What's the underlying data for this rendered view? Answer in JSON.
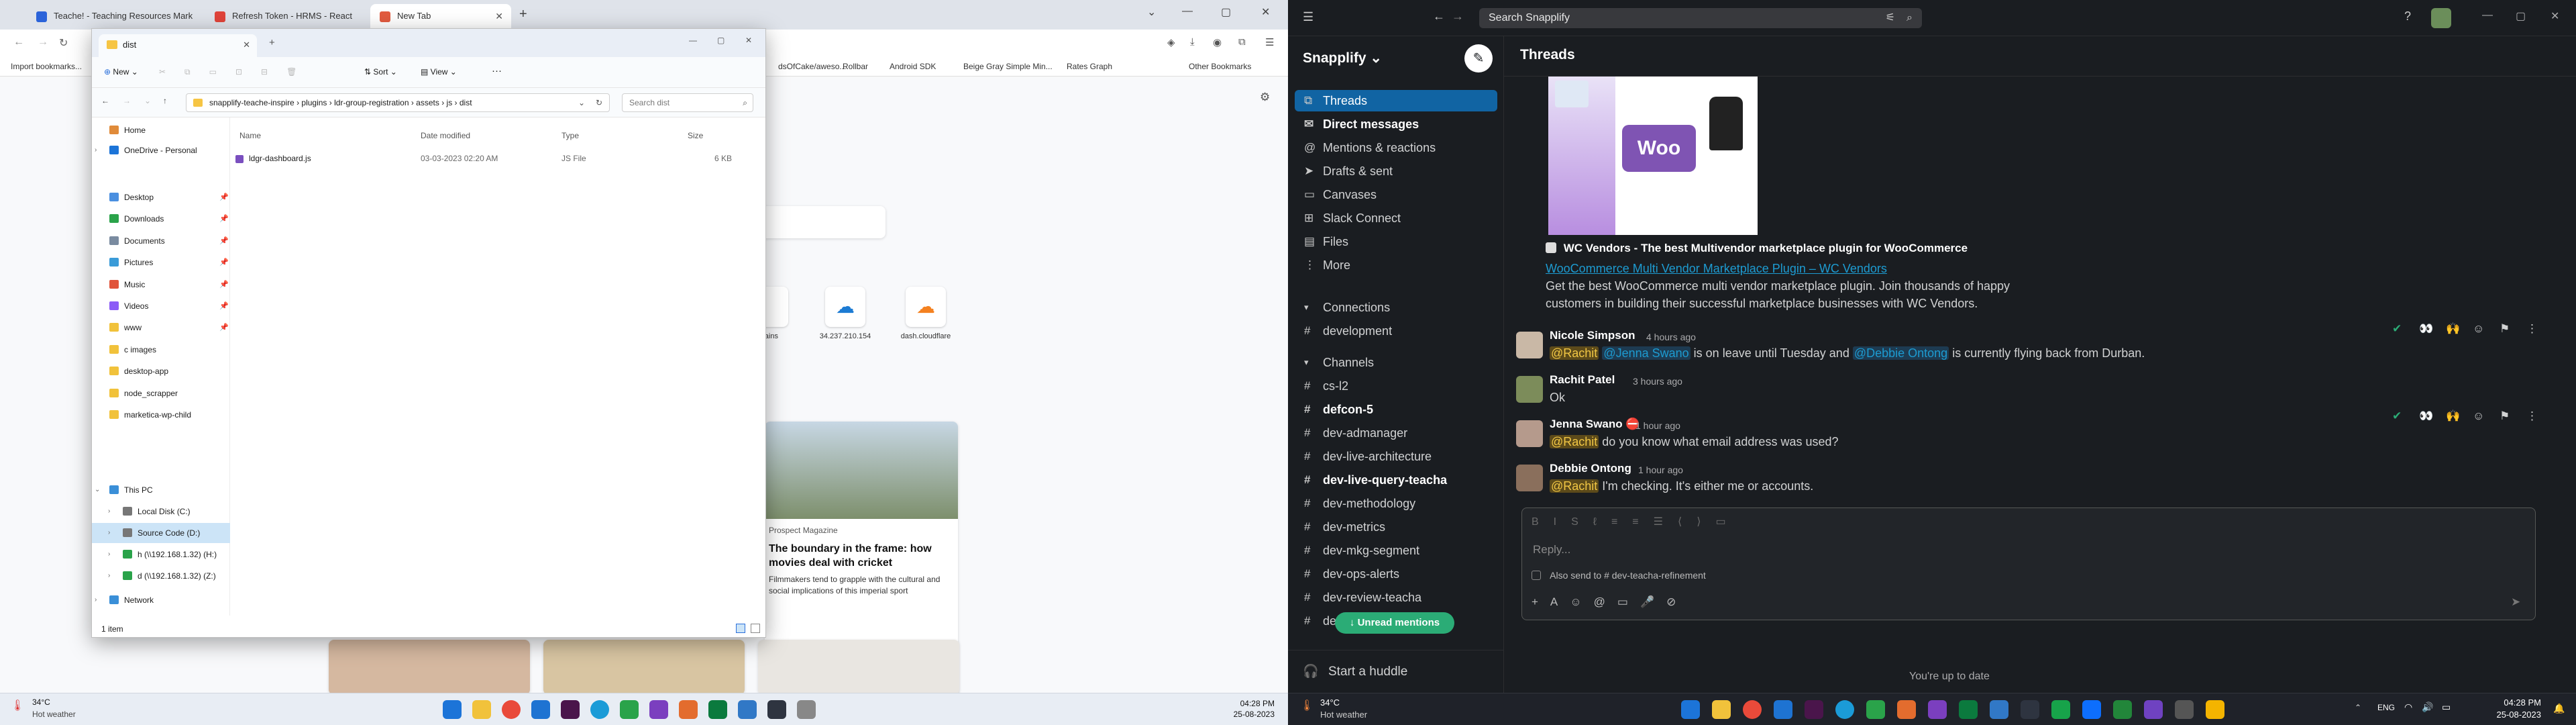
{
  "left": {
    "browser": {
      "tabs": [
        {
          "label": "Teache! - Teaching Resources Mark",
          "color": "#2b63d9"
        },
        {
          "label": "Refresh Token - HRMS - React",
          "color": "#e0433a"
        },
        {
          "label": "New Tab",
          "color": "#e25b3f"
        }
      ],
      "new_tab_symbol": "+",
      "bookmarks": [
        "Import bookmarks...",
        "dsOfCake/aweso...",
        "Rollbar",
        "Android SDK",
        "Beige Gray Simple Min...",
        "Rates Graph",
        "Other Bookmarks"
      ]
    },
    "explorer": {
      "title": "dist",
      "new_label": "New",
      "sort_label": "Sort",
      "view_label": "View",
      "more_label": "···",
      "breadcrumb": [
        "snapplify-teache-inspire",
        "plugins",
        "ldr-group-registration",
        "assets",
        "js",
        "dist"
      ],
      "search_placeholder": "Search dist",
      "nav": {
        "home": "Home",
        "onedrive": "OneDrive - Personal",
        "quick": [
          "Desktop",
          "Downloads",
          "Documents",
          "Pictures",
          "Music",
          "Videos",
          "www",
          "c images",
          "desktop-app",
          "node_scrapper",
          "marketica-wp-child"
        ],
        "this_pc": "This PC",
        "drives": [
          "Local Disk (C:)",
          "Source Code (D:)",
          "h (\\\\192.168.1.32) (H:)",
          "d (\\\\192.168.1.32) (Z:)"
        ],
        "network": "Network"
      },
      "columns": [
        "Name",
        "Date modified",
        "Type",
        "Size"
      ],
      "files": [
        {
          "name": "ldgr-dashboard.js",
          "date": "03-03-2023 02:20 AM",
          "type": "JS File",
          "size": "6 KB"
        }
      ],
      "status": "1 item"
    },
    "news": {
      "shortcut_labels": [
        "brains",
        "34.237.210.154",
        "dash.cloudflare"
      ],
      "source": "Prospect Magazine",
      "headline": "The boundary in the frame: how movies deal with cricket",
      "snippet": "Filmmakers tend to grapple with the cultural and social implications of this imperial sport"
    },
    "taskbar": {
      "temp": "34°C",
      "weather": "Hot weather",
      "time": "04:28 PM",
      "date": "25-08-2023"
    }
  },
  "right": {
    "search_placeholder": "Search Snapplify",
    "workspace": "Snapplify",
    "header_title": "Threads",
    "nav": [
      {
        "label": "Threads",
        "icon": "threads-icon",
        "glyph": "⧉",
        "bold": false,
        "selected": true
      },
      {
        "label": "Direct messages",
        "icon": "dm-icon",
        "glyph": "✉",
        "bold": true,
        "selected": false
      },
      {
        "label": "Mentions & reactions",
        "icon": "at-icon",
        "glyph": "@",
        "bold": false,
        "selected": false
      },
      {
        "label": "Drafts & sent",
        "icon": "send-icon",
        "glyph": "➤",
        "bold": false,
        "selected": false
      },
      {
        "label": "Canvases",
        "icon": "canvas-icon",
        "glyph": "▭",
        "bold": false,
        "selected": false
      },
      {
        "label": "Slack Connect",
        "icon": "connect-icon",
        "glyph": "⊞",
        "bold": false,
        "selected": false
      },
      {
        "label": "Files",
        "icon": "files-icon",
        "glyph": "▤",
        "bold": false,
        "selected": false
      },
      {
        "label": "More",
        "icon": "more-icon",
        "glyph": "⋮",
        "bold": false,
        "selected": false
      }
    ],
    "connections_header": "Connections",
    "connections": [
      {
        "label": "development",
        "bold": false
      }
    ],
    "channels_header": "Channels",
    "channels": [
      {
        "label": "cs-l2",
        "bold": false
      },
      {
        "label": "defcon-5",
        "bold": true
      },
      {
        "label": "dev-admanager",
        "bold": false
      },
      {
        "label": "dev-live-architecture",
        "bold": false
      },
      {
        "label": "dev-live-query-teacha",
        "bold": true
      },
      {
        "label": "dev-methodology",
        "bold": false
      },
      {
        "label": "dev-metrics",
        "bold": false
      },
      {
        "label": "dev-mkg-segment",
        "bold": false
      },
      {
        "label": "dev-ops-alerts",
        "bold": false
      },
      {
        "label": "dev-review-teacha",
        "bold": false
      },
      {
        "label": "de",
        "bold": false
      }
    ],
    "unread_label": "↓ Unread mentions",
    "huddle_label": "Start a huddle",
    "unfurl": {
      "title": "WC Vendors - The best Multivendor marketplace plugin for WooCommerce",
      "link": "WooCommerce Multi Vendor Marketplace Plugin – WC Vendors",
      "desc1": "Get the best WooCommerce multi vendor marketplace plugin. Join thousands of happy",
      "desc2": "customers in building their successful marketplace businesses with WC Vendors.",
      "logo": "Woo"
    },
    "messages": [
      {
        "name": "Nicole Simpson",
        "time": "4 hours ago",
        "parts": [
          "@Rachit",
          " ",
          "@Jenna Swano",
          " is on leave until Tuesday and ",
          "@Debbie Ontong",
          " is currently flying back from Durban."
        ]
      },
      {
        "name": "Rachit Patel",
        "time": "3 hours ago",
        "text": "Ok"
      },
      {
        "name": "Jenna Swano ⛔",
        "time": "1 hour ago",
        "mention": "@Rachit",
        "text": " do you know what email address was used?"
      },
      {
        "name": "Debbie Ontong",
        "time": "1 hour ago",
        "mention": "@Rachit",
        "text": " I'm checking. It's either me or accounts."
      }
    ],
    "composer": {
      "placeholder": "Reply...",
      "also_send": "Also send to # dev-teacha-refinement"
    },
    "footer_peek": "You're up to date",
    "taskbar": {
      "temp": "34°C",
      "weather": "Hot weather",
      "lang": "ENG",
      "time": "04:28 PM",
      "date": "25-08-2023"
    }
  }
}
